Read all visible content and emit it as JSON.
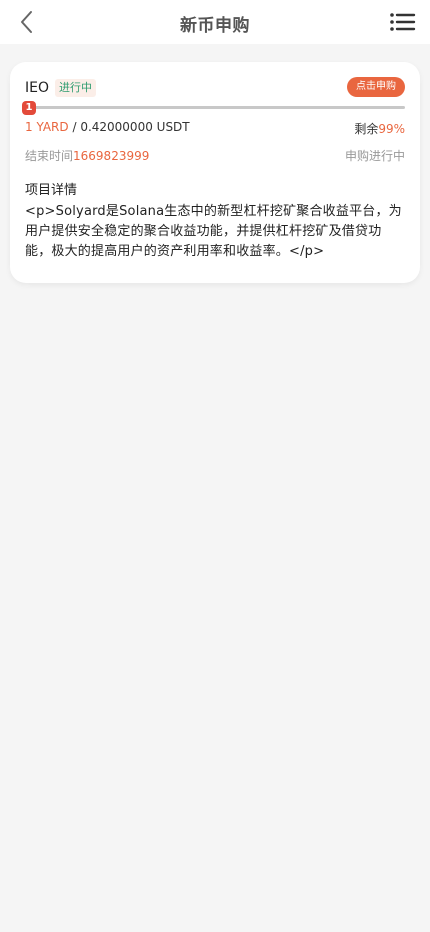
{
  "header": {
    "title": "新币申购",
    "back_icon": "chevron-left-icon",
    "menu_icon": "list-menu-icon"
  },
  "offering": {
    "coin": "IEO",
    "status_tag": "进行中",
    "subscribe_label": "点击申购",
    "progress_badge": "1",
    "progress_fraction": 0.01,
    "quantity": "1 YARD",
    "separator": " / ",
    "price": "0.42000000 USDT",
    "remaining_label": "剩余",
    "remaining_value": "99%",
    "end_time_label": "结束时间",
    "end_time_value": "1669823999",
    "sub_status": "申购进行中",
    "detail_heading": "项目详情",
    "detail_body": "<p>Solyard是Solana生态中的新型杠杆挖矿聚合收益平台，为用户提供安全稳定的聚合收益功能，并提供杠杆挖矿及借贷功能，极大的提高用户的资产利用率和收益率。</p>"
  },
  "colors": {
    "accent": "#e9663f",
    "badge": "#e34a3a",
    "status_green": "#2f9c6f",
    "background": "#f5f5f5"
  }
}
